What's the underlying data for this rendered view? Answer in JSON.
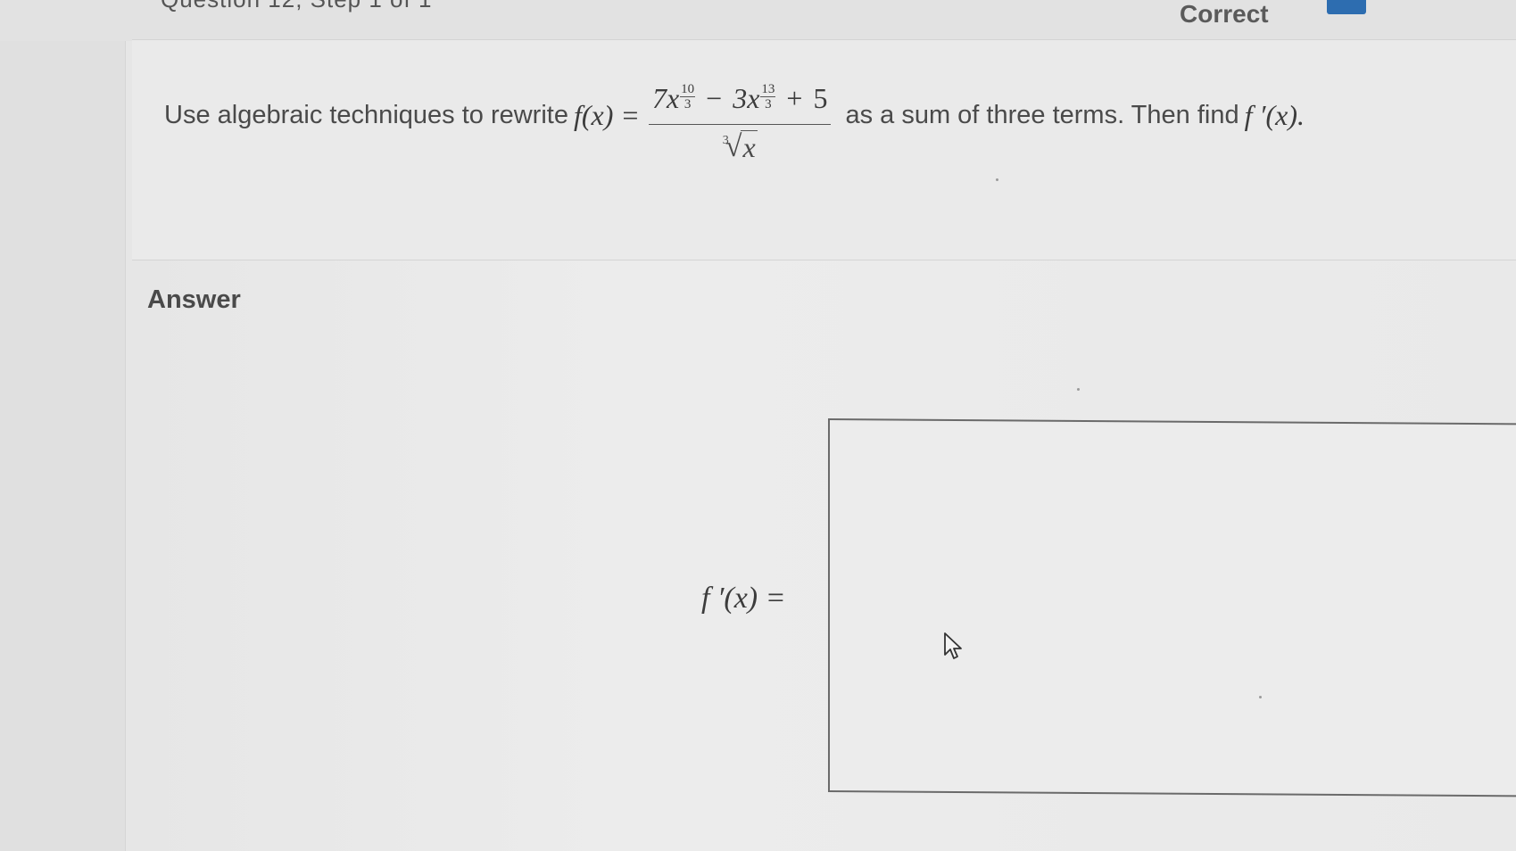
{
  "header": {
    "cut_off_text": "Question 12, Step 1 of 1",
    "status_label": "Correct"
  },
  "question": {
    "prefix_text": "Use algebraic techniques to rewrite",
    "function_lhs": "f(x) =",
    "numerator": {
      "term1_coef": "7x",
      "term1_exp_num": "10",
      "term1_exp_den": "3",
      "op1": "−",
      "term2_coef": "3x",
      "term2_exp_num": "13",
      "term2_exp_den": "3",
      "op2": "+",
      "term3": "5"
    },
    "denominator": {
      "root_index": "3",
      "radical_sign": "√",
      "radicand": "x"
    },
    "suffix_text": "as a sum of three terms. Then find",
    "derivative_ref": "f ′(x)."
  },
  "answer": {
    "section_label": "Answer",
    "input_label": "f ′(x) =",
    "input_value": ""
  },
  "colors": {
    "accent_button": "#2d6db0",
    "background": "#e9e9e9",
    "text": "#4a4a4a"
  }
}
